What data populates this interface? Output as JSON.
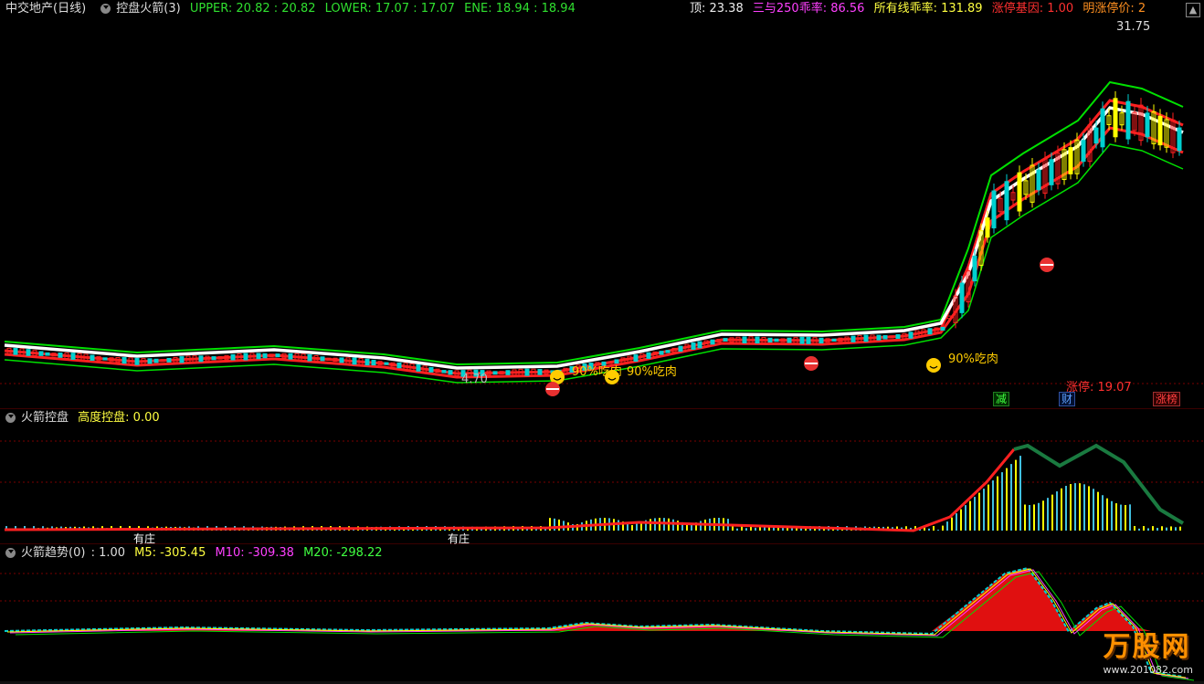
{
  "main": {
    "stock_title": "中交地产(日线)",
    "indicator_name": "控盘火箭(3)",
    "upper_label": "UPPER: 20.82 : 20.82",
    "lower_label": "LOWER: 17.07 : 17.07",
    "ene_label": "ENE: 18.94 : 18.94",
    "top_label": "顶: 23.38",
    "ratio250_label": "三与250乖率: 86.56",
    "allline_label": "所有线乖率: 131.89",
    "limit_gene_label": "涨停基因: 1.00",
    "tomorrow_label": "明涨停价: 2",
    "high_price": "31.75",
    "low_price": "4.70",
    "eat_labels": [
      "90%吃肉",
      "90%吃肉",
      "90%吃肉"
    ],
    "limit_up_label": "涨停: 19.07",
    "badges": [
      "减",
      "财",
      "涨榜"
    ]
  },
  "panel2": {
    "name": "火箭控盘",
    "value_label": "高度控盘: 0.00",
    "markers": [
      "有庄",
      "有庄"
    ]
  },
  "panel3": {
    "name": "火箭趋势(0)",
    "value": ": 1.00",
    "m5_label": "M5: -305.45",
    "m10_label": "M10: -309.38",
    "m20_label": "M20: -298.22"
  },
  "watermark": {
    "brand": "万股网",
    "url": "www.201082.com"
  },
  "colors": {
    "up": "#ff2020",
    "down": "#00d0d0",
    "yellow": "#ffff00",
    "green": "#00e000",
    "white": "#ffffff",
    "magenta": "#ff40ff",
    "gridline": "#7a0000"
  }
}
